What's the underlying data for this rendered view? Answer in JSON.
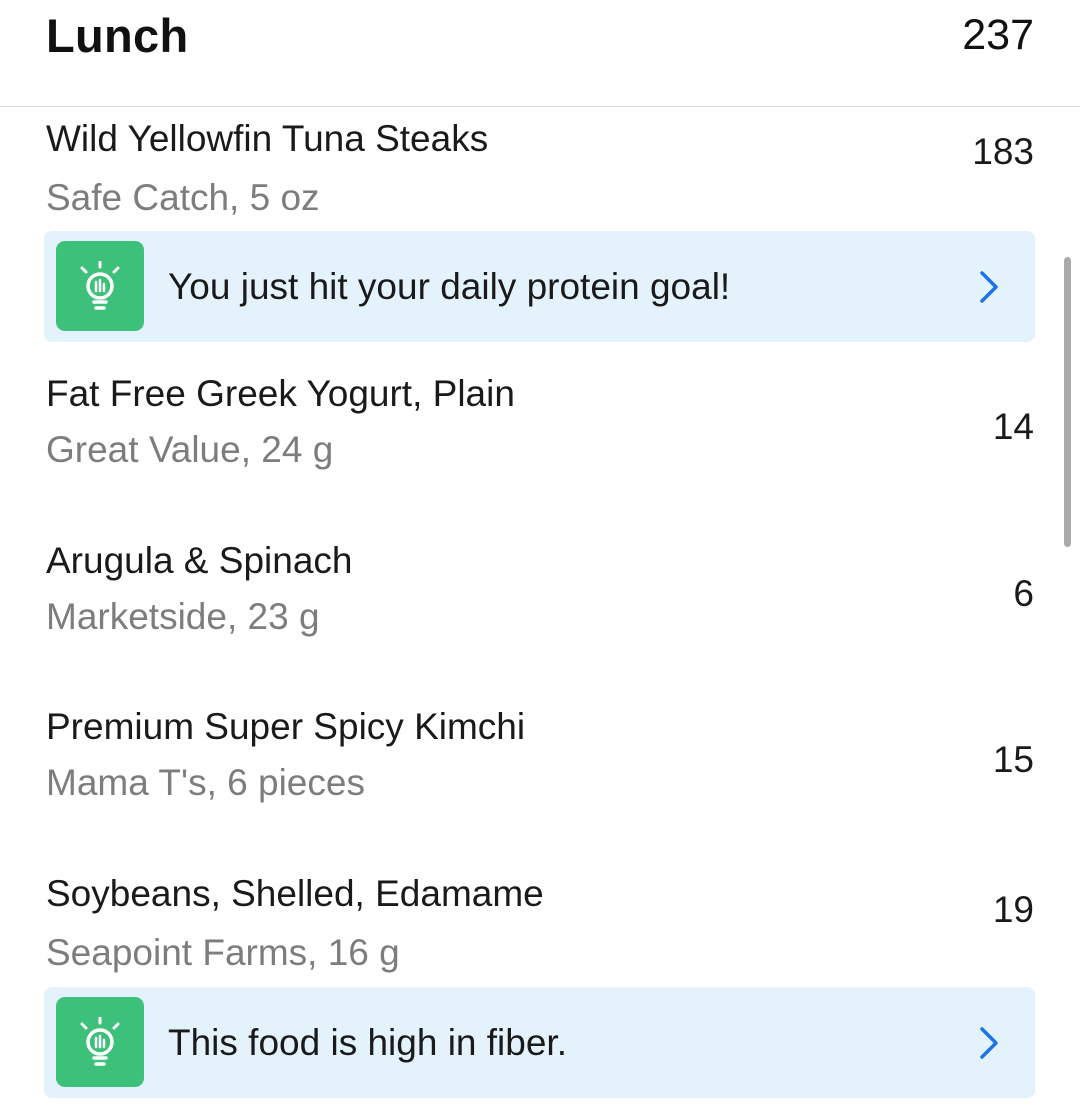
{
  "meal": {
    "title": "Lunch",
    "total_calories": "237"
  },
  "foods": [
    {
      "name": "Wild Yellowfin Tuna Steaks",
      "detail": "Safe Catch, 5 oz",
      "calories": "183"
    },
    {
      "name": "Fat Free Greek Yogurt, Plain",
      "detail": "Great Value, 24 g",
      "calories": "14"
    },
    {
      "name": "Arugula & Spinach",
      "detail": "Marketside, 23 g",
      "calories": "6"
    },
    {
      "name": "Premium Super Spicy Kimchi",
      "detail": "Mama T's, 6 pieces",
      "calories": "15"
    },
    {
      "name": "Soybeans, Shelled, Edamame",
      "detail": "Seapoint Farms, 16 g",
      "calories": "19"
    }
  ],
  "tips": [
    {
      "text": "You just hit your daily protein goal!",
      "icon": "lightbulb-icon"
    },
    {
      "text": "This food is high in fiber.",
      "icon": "lightbulb-icon"
    }
  ],
  "colors": {
    "tip_background": "#e4f2fb",
    "icon_green": "#3dc07a",
    "chevron_blue": "#1a73e8",
    "secondary_text": "#7d7d7d"
  }
}
